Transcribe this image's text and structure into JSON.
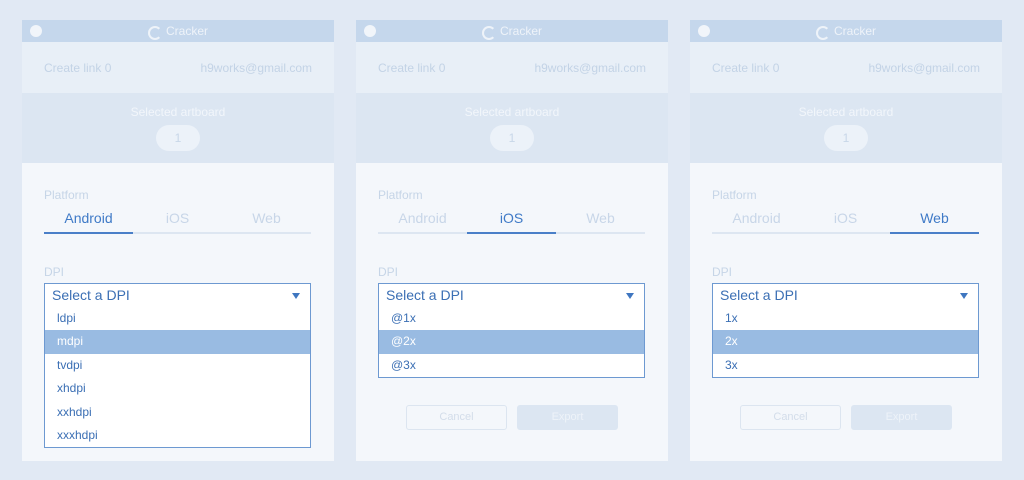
{
  "app": {
    "title": "Cracker",
    "logo_icon": "cracker-logo-icon"
  },
  "colors": {
    "accent": "#4a7fc8",
    "selected_option_bg": "#99bbe2",
    "titlebar_bg": "#c5d7ec",
    "page_bg": "#e1e9f4"
  },
  "panels": [
    {
      "title": "Cracker",
      "account": {
        "link_text": "Create link 0",
        "email": "h9works@gmail.com"
      },
      "artboard": {
        "label": "Selected artboard",
        "count": "1"
      },
      "platform": {
        "label": "Platform",
        "tabs": [
          {
            "label": "Android"
          },
          {
            "label": "iOS"
          },
          {
            "label": "Web"
          }
        ],
        "active": "Android"
      },
      "dpi": {
        "label": "DPI",
        "placeholder": "Select a DPI",
        "options": [
          {
            "label": "ldpi"
          },
          {
            "label": "mdpi"
          },
          {
            "label": "tvdpi"
          },
          {
            "label": "xhdpi"
          },
          {
            "label": "xxhdpi"
          },
          {
            "label": "xxxhdpi"
          }
        ],
        "highlighted": "mdpi"
      }
    },
    {
      "title": "Cracker",
      "account": {
        "link_text": "Create link 0",
        "email": "h9works@gmail.com"
      },
      "artboard": {
        "label": "Selected artboard",
        "count": "1"
      },
      "platform": {
        "label": "Platform",
        "tabs": [
          {
            "label": "Android"
          },
          {
            "label": "iOS"
          },
          {
            "label": "Web"
          }
        ],
        "active": "iOS"
      },
      "dpi": {
        "label": "DPI",
        "placeholder": "Select a DPI",
        "options": [
          {
            "label": "@1x"
          },
          {
            "label": "@2x"
          },
          {
            "label": "@3x"
          }
        ],
        "highlighted": "@2x"
      },
      "actions": {
        "cancel": "Cancel",
        "export": "Export"
      }
    },
    {
      "title": "Cracker",
      "account": {
        "link_text": "Create link 0",
        "email": "h9works@gmail.com"
      },
      "artboard": {
        "label": "Selected artboard",
        "count": "1"
      },
      "platform": {
        "label": "Platform",
        "tabs": [
          {
            "label": "Android"
          },
          {
            "label": "iOS"
          },
          {
            "label": "Web"
          }
        ],
        "active": "Web"
      },
      "dpi": {
        "label": "DPI",
        "placeholder": "Select a DPI",
        "options": [
          {
            "label": "1x"
          },
          {
            "label": "2x"
          },
          {
            "label": "3x"
          }
        ],
        "highlighted": "2x"
      },
      "actions": {
        "cancel": "Cancel",
        "export": "Export"
      }
    }
  ]
}
